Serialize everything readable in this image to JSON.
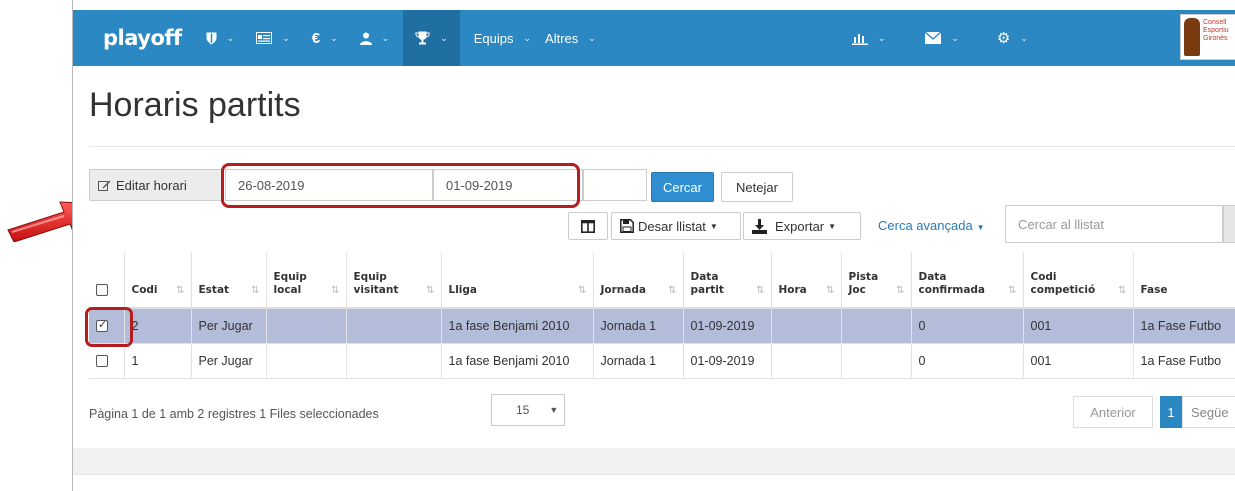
{
  "navbar": {
    "brand": "playoff",
    "menus": [
      "Equips",
      "Altres"
    ],
    "logo_text": [
      "Consell",
      "Esportiu",
      "Gironès"
    ],
    "colors": {
      "bar": "#2b88c2",
      "active": "#1f6fa3"
    }
  },
  "page": {
    "title": "Horaris partits"
  },
  "toolbar": {
    "edit_label": "Editar horari",
    "date_from": "26-08-2019",
    "date_to": "01-09-2019",
    "search_button": "Cercar",
    "clear_button": "Netejar",
    "save_list": "Desar llistat",
    "export": "Exportar",
    "advanced_search": "Cerca avançada",
    "search_placeholder": "Cercar al llistat"
  },
  "table": {
    "headers": [
      [
        "Codi"
      ],
      [
        "Estat"
      ],
      [
        "Equip",
        "local"
      ],
      [
        "Equip",
        "visitant"
      ],
      [
        "Lliga"
      ],
      [
        "Jornada"
      ],
      [
        "Data",
        "partit"
      ],
      [
        "Hora"
      ],
      [
        "Pista",
        "Joc"
      ],
      [
        "Data",
        "confirmada"
      ],
      [
        "Codi",
        "competició"
      ],
      [
        "Fase"
      ]
    ],
    "rows": [
      {
        "selected": true,
        "cells": [
          "2",
          "Per Jugar",
          "",
          "",
          "1a fase Benjami 2010",
          "Jornada 1",
          "01-09-2019",
          "",
          "",
          "0",
          "001",
          "1a Fase Futbo"
        ]
      },
      {
        "selected": false,
        "cells": [
          "1",
          "Per Jugar",
          "",
          "",
          "1a fase Benjami 2010",
          "Jornada 1",
          "01-09-2019",
          "",
          "",
          "0",
          "001",
          "1a Fase Futbo"
        ]
      }
    ]
  },
  "footer": {
    "page_info": "Pàgina 1 de 1 amb 2 registres   1 Files seleccionades",
    "page_size": "15",
    "prev": "Anterior",
    "current": "1",
    "next": "Següe"
  }
}
